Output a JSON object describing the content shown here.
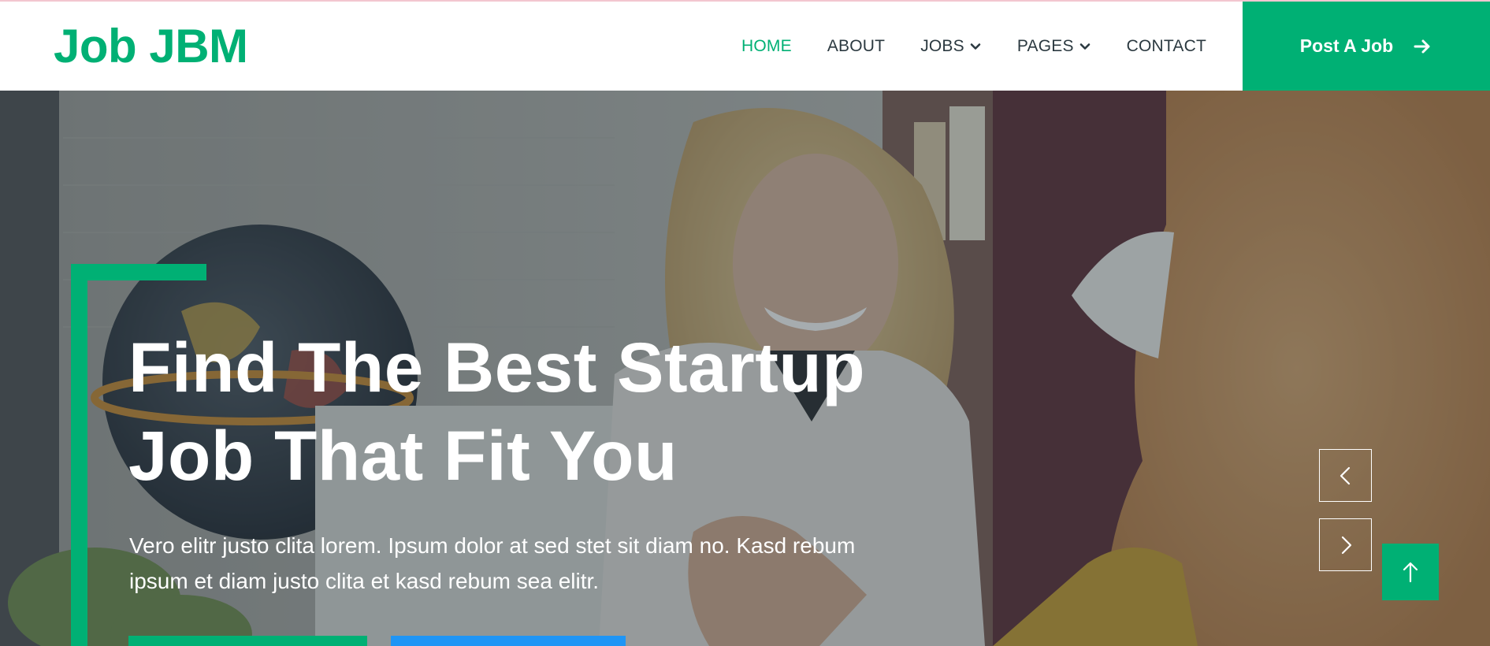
{
  "brand": {
    "name": "Job JBM",
    "color": "#00b074"
  },
  "nav": {
    "items": [
      {
        "label": "HOME",
        "active": true,
        "dropdown": false
      },
      {
        "label": "ABOUT",
        "active": false,
        "dropdown": false
      },
      {
        "label": "JOBS",
        "active": false,
        "dropdown": true
      },
      {
        "label": "PAGES",
        "active": false,
        "dropdown": true
      },
      {
        "label": "CONTACT",
        "active": false,
        "dropdown": false
      }
    ],
    "cta_label": "Post A Job",
    "cta_icon": "arrow-right-icon"
  },
  "hero": {
    "title_line1": "Find The Best Startup",
    "title_line2": "Job That Fit You",
    "text_line1": "Vero elitr justo clita lorem. Ipsum dolor at sed stet sit diam no. Kasd rebum",
    "text_line2": "ipsum et diam justo clita et kasd rebum sea elitr.",
    "carousel_prev_icon": "chevron-left-icon",
    "carousel_next_icon": "chevron-right-icon",
    "back_to_top_icon": "arrow-up-icon"
  },
  "colors": {
    "primary": "#00b074",
    "secondary": "#1f95f5",
    "dark": "#2b3940"
  }
}
